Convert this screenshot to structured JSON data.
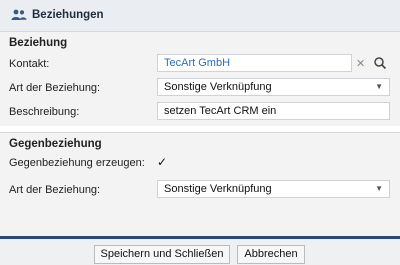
{
  "dialog": {
    "title": "Beziehungen",
    "title_icon": "users-icon"
  },
  "relation": {
    "section_title": "Beziehung",
    "contact_label": "Kontakt:",
    "contact_value": "TecArt GmbH",
    "type_label": "Art der Beziehung:",
    "type_value": "Sonstige Verknüpfung",
    "description_label": "Beschreibung:",
    "description_value": "setzen TecArt CRM ein"
  },
  "counter_relation": {
    "section_title": "Gegenbeziehung",
    "create_label": "Gegenbeziehung erzeugen:",
    "create_checked": true,
    "type_label": "Art der Beziehung:",
    "type_value": "Sonstige Verknüpfung"
  },
  "buttons": {
    "save_close": "Speichern und Schließen",
    "cancel": "Abbrechen"
  },
  "colors": {
    "link": "#2f6fb6",
    "footer_border": "#2c4a74"
  }
}
